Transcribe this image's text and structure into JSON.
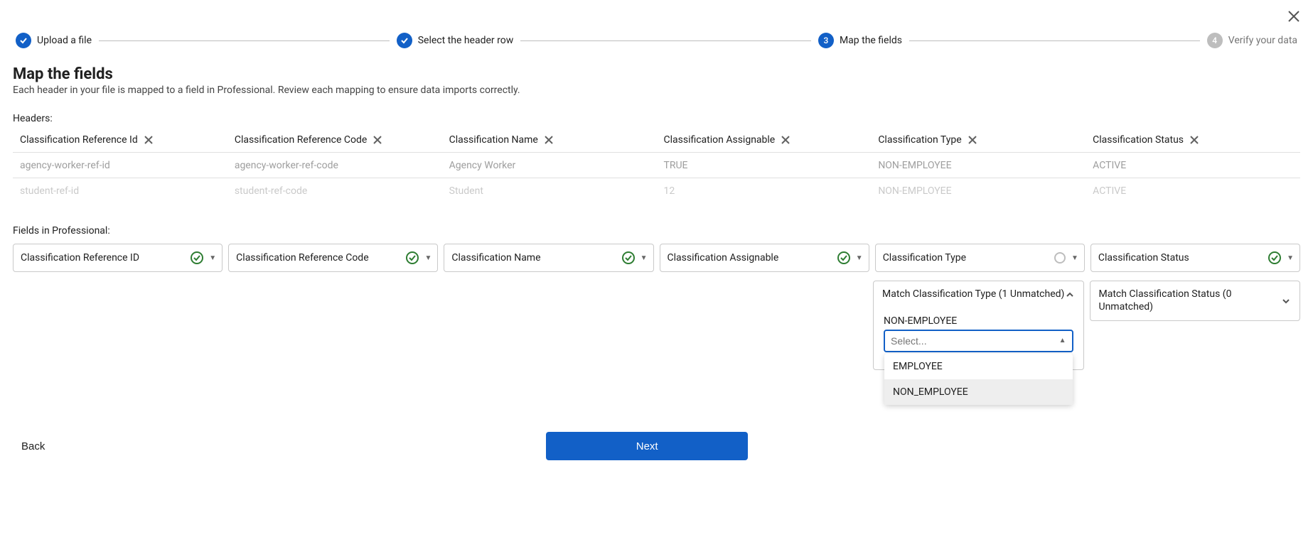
{
  "stepper": {
    "steps": [
      {
        "label": "Upload a file",
        "state": "done"
      },
      {
        "label": "Select the header row",
        "state": "done"
      },
      {
        "label": "Map the fields",
        "state": "current",
        "num": "3"
      },
      {
        "label": "Verify your data",
        "state": "future",
        "num": "4"
      }
    ]
  },
  "heading": {
    "title": "Map the fields",
    "subtitle": "Each header in your file is mapped to a field in Professional. Review each mapping to ensure data imports correctly."
  },
  "headers_section": {
    "label": "Headers:",
    "columns": [
      "Classification Reference Id",
      "Classification Reference Code",
      "Classification Name",
      "Classification Assignable",
      "Classification Type",
      "Classification Status"
    ],
    "rows": [
      [
        "agency-worker-ref-id",
        "agency-worker-ref-code",
        "Agency Worker",
        "TRUE",
        "NON-EMPLOYEE",
        "ACTIVE"
      ],
      [
        "student-ref-id",
        "student-ref-code",
        "Student",
        "12",
        "NON-EMPLOYEE",
        "ACTIVE"
      ]
    ]
  },
  "fields_section": {
    "label": "Fields in Professional:",
    "fields": [
      {
        "label": "Classification Reference ID",
        "status": "ok"
      },
      {
        "label": "Classification Reference Code",
        "status": "ok"
      },
      {
        "label": "Classification Name",
        "status": "ok"
      },
      {
        "label": "Classification Assignable",
        "status": "ok"
      },
      {
        "label": "Classification Type",
        "status": "pending"
      },
      {
        "label": "Classification Status",
        "status": "ok"
      }
    ]
  },
  "match_type": {
    "header": "Match Classification Type (1 Unmatched)",
    "value_label": "NON-EMPLOYEE",
    "placeholder": "Select...",
    "options": [
      "EMPLOYEE",
      "NON_EMPLOYEE"
    ],
    "highlighted": 1
  },
  "match_status": {
    "header": "Match Classification Status (0 Unmatched)"
  },
  "footer": {
    "back": "Back",
    "next": "Next"
  }
}
